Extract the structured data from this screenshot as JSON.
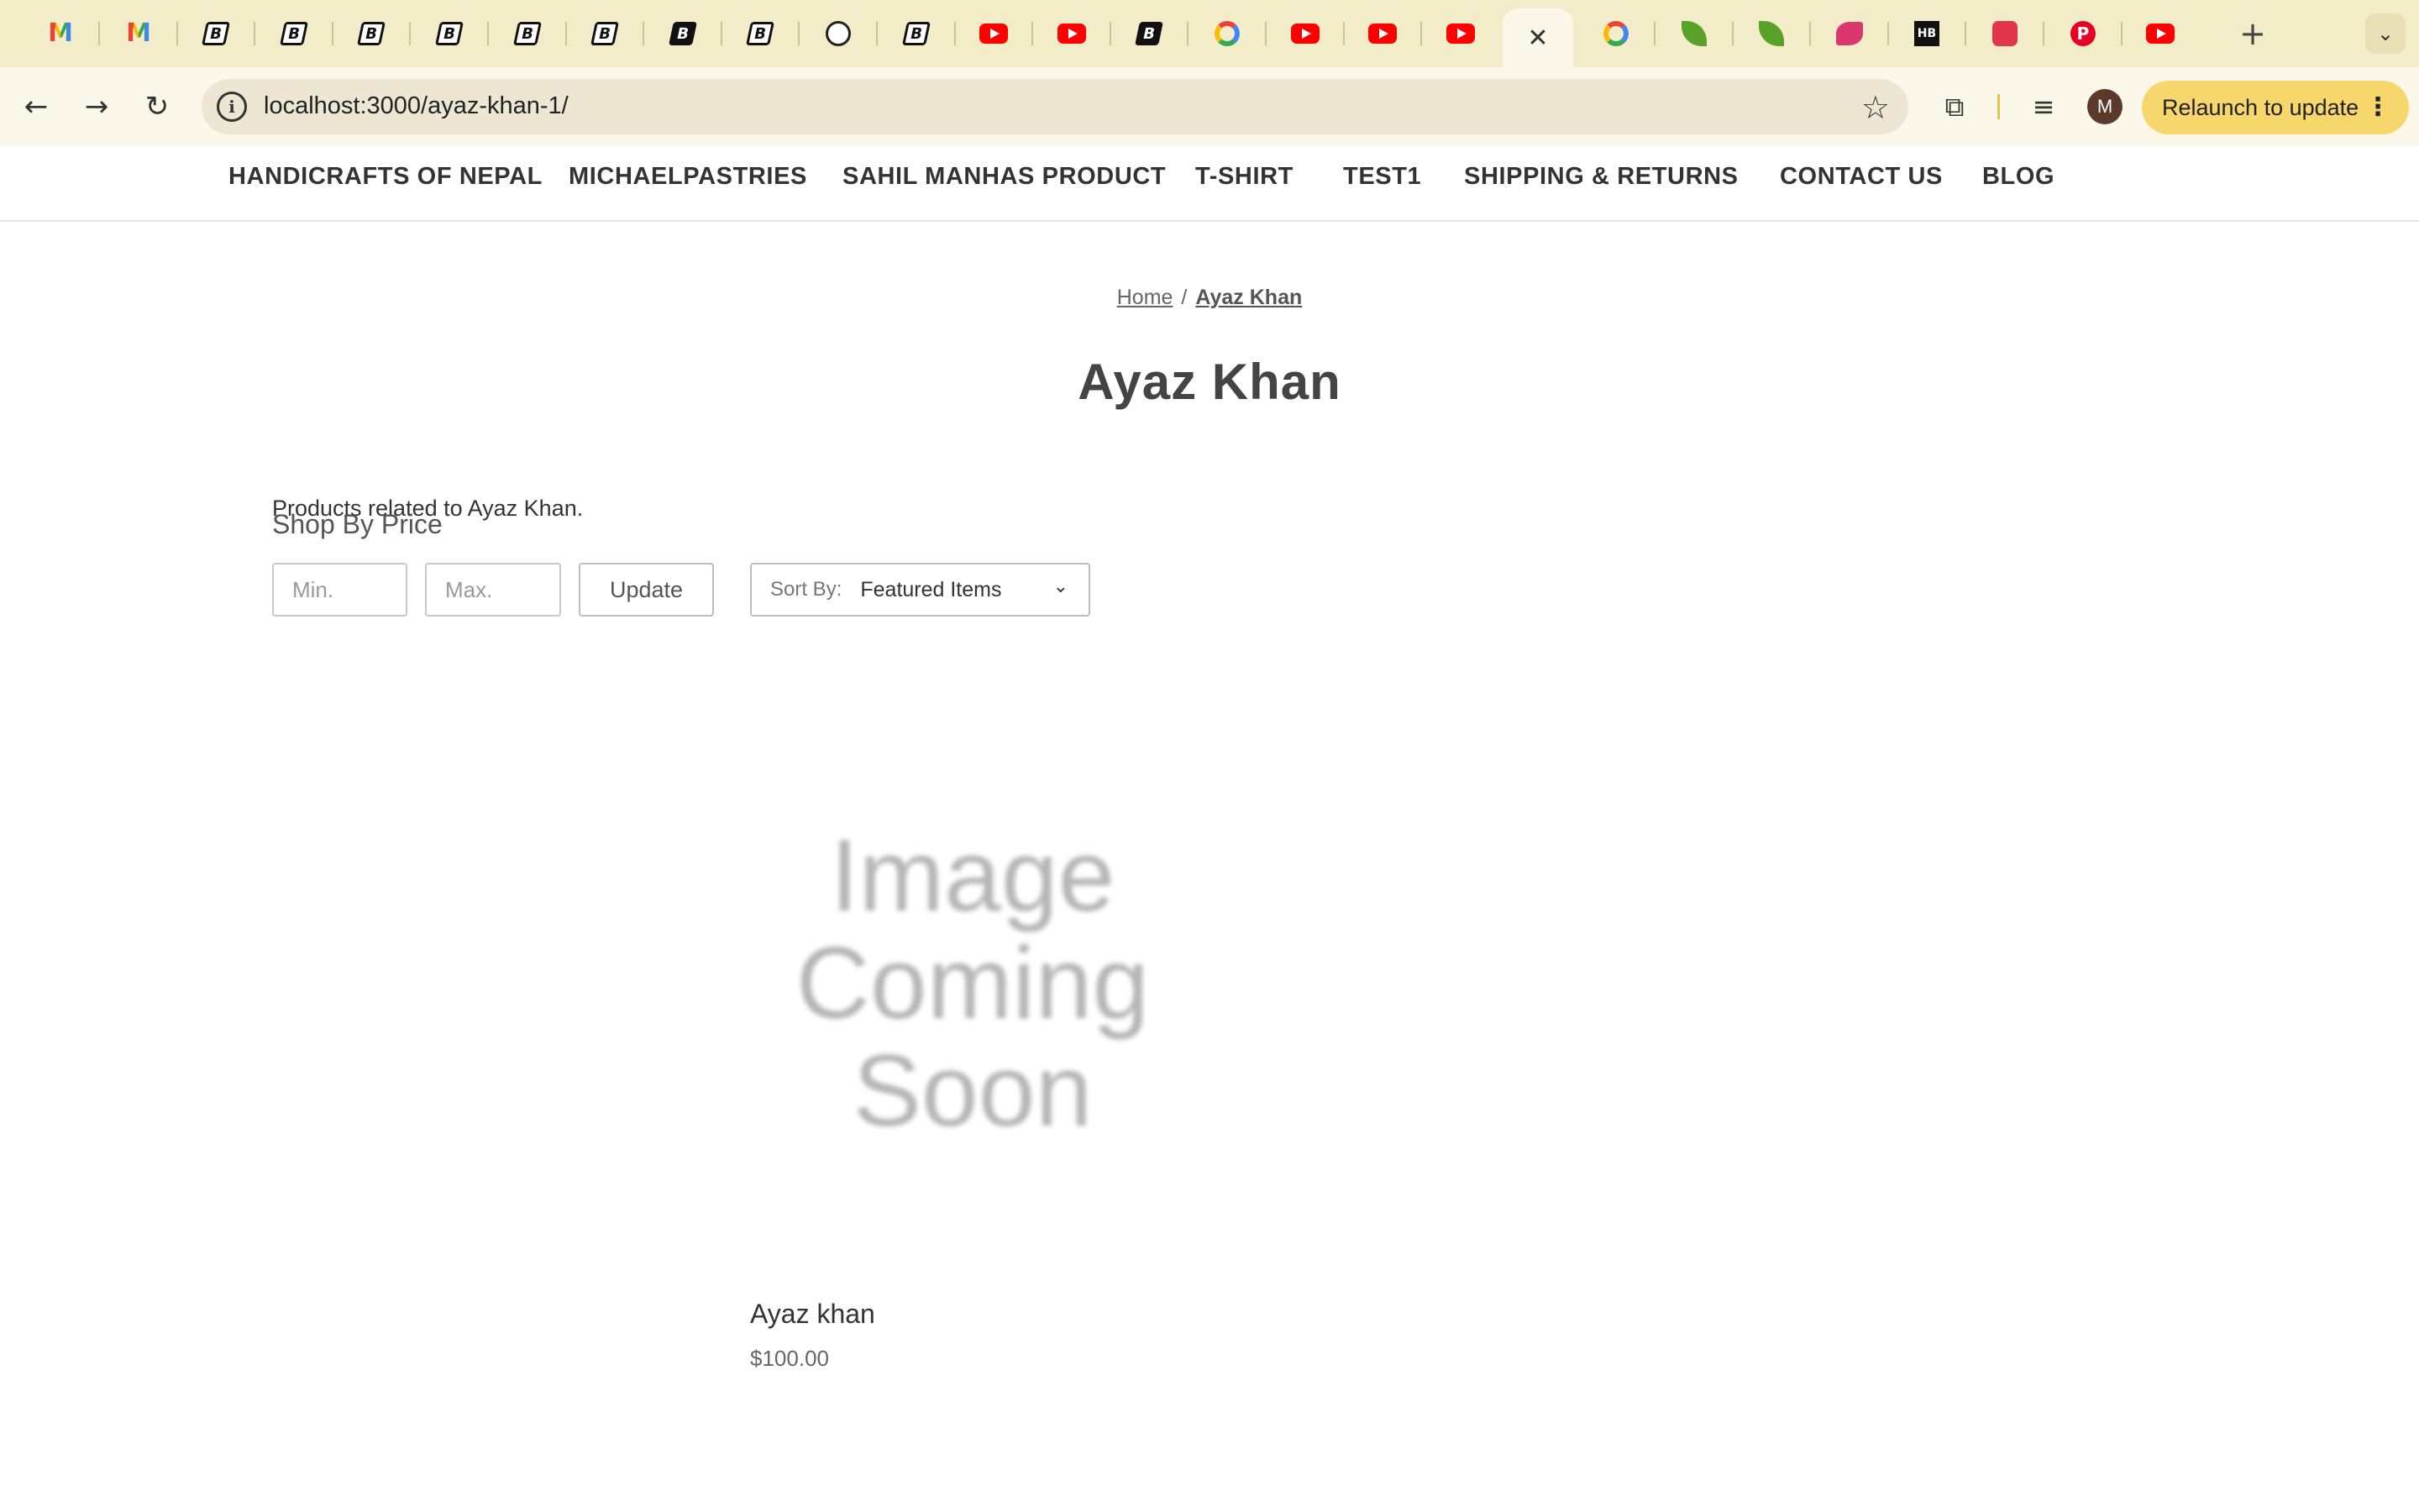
{
  "browser": {
    "tabs": [
      {
        "icon": "gmail-icon",
        "glyph": "M"
      },
      {
        "icon": "gmail-icon",
        "glyph": "M"
      },
      {
        "icon": "bigcommerce-icon",
        "glyph": "B"
      },
      {
        "icon": "bigcommerce-icon",
        "glyph": "B"
      },
      {
        "icon": "bigcommerce-icon",
        "glyph": "B"
      },
      {
        "icon": "bigcommerce-icon",
        "glyph": "B"
      },
      {
        "icon": "bigcommerce-icon",
        "glyph": "B"
      },
      {
        "icon": "bigcommerce-icon",
        "glyph": "B"
      },
      {
        "icon": "bigcommerce-dark-icon",
        "glyph": "B"
      },
      {
        "icon": "bigcommerce-icon",
        "glyph": "B"
      },
      {
        "icon": "openai-icon",
        "glyph": ""
      },
      {
        "icon": "bigcommerce-icon",
        "glyph": "B"
      },
      {
        "icon": "youtube-icon",
        "glyph": ""
      },
      {
        "icon": "youtube-icon",
        "glyph": ""
      },
      {
        "icon": "bigcommerce-dark-icon",
        "glyph": "B"
      },
      {
        "icon": "google-icon",
        "glyph": ""
      },
      {
        "icon": "youtube-icon",
        "glyph": ""
      },
      {
        "icon": "youtube-icon",
        "glyph": ""
      },
      {
        "icon": "youtube-icon",
        "glyph": ""
      },
      {
        "icon": "close-icon",
        "glyph": "✕",
        "active": true
      },
      {
        "icon": "google-icon",
        "glyph": ""
      },
      {
        "icon": "leaf-icon",
        "glyph": ""
      },
      {
        "icon": "leaf-icon",
        "glyph": ""
      },
      {
        "icon": "brand-pink-icon",
        "glyph": ""
      },
      {
        "icon": "hb-icon",
        "glyph": "HB"
      },
      {
        "icon": "red-app-icon",
        "glyph": ""
      },
      {
        "icon": "pinterest-icon",
        "glyph": "P"
      },
      {
        "icon": "youtube-icon",
        "glyph": ""
      }
    ],
    "new_tab_glyph": "+",
    "tab_search_glyph": "⌄",
    "back_glyph": "←",
    "forward_glyph": "→",
    "reload_glyph": "↻",
    "url": "localhost:3000/ayaz-khan-1/",
    "bookmark_glyph": "☆",
    "extensions_glyph": "⧉",
    "media_glyph": "≡",
    "profile_initial": "M",
    "relaunch_label": "Relaunch to update",
    "menu_glyph": "⋮",
    "colors": {
      "tabstrip": "#f3ecc8",
      "toolbar": "#fbf8ea",
      "relaunch": "#f7d76b"
    }
  },
  "store_nav": {
    "items": [
      "HANDICRAFTS OF NEPAL",
      "MICHAELPASTRIES",
      "SAHIL MANHAS PRODUCT",
      "T-SHIRT",
      "TEST1",
      "SHIPPING & RETURNS",
      "CONTACT US",
      "BLOG"
    ]
  },
  "breadcrumb": {
    "home": "Home",
    "separator": "/",
    "current": "Ayaz Khan"
  },
  "page": {
    "title": "Ayaz Khan",
    "description": "Products related to Ayaz Khan.",
    "shop_by_price": "Shop By Price"
  },
  "filters": {
    "min_placeholder": "Min.",
    "max_placeholder": "Max.",
    "update_label": "Update",
    "sort_label": "Sort By:",
    "sort_value": "Featured Items",
    "chevron_glyph": "⌄"
  },
  "products": [
    {
      "image_text_1": "Image",
      "image_text_2": "Coming",
      "image_text_3": "Soon",
      "name": "Ayaz khan",
      "price": "$100.00"
    }
  ]
}
